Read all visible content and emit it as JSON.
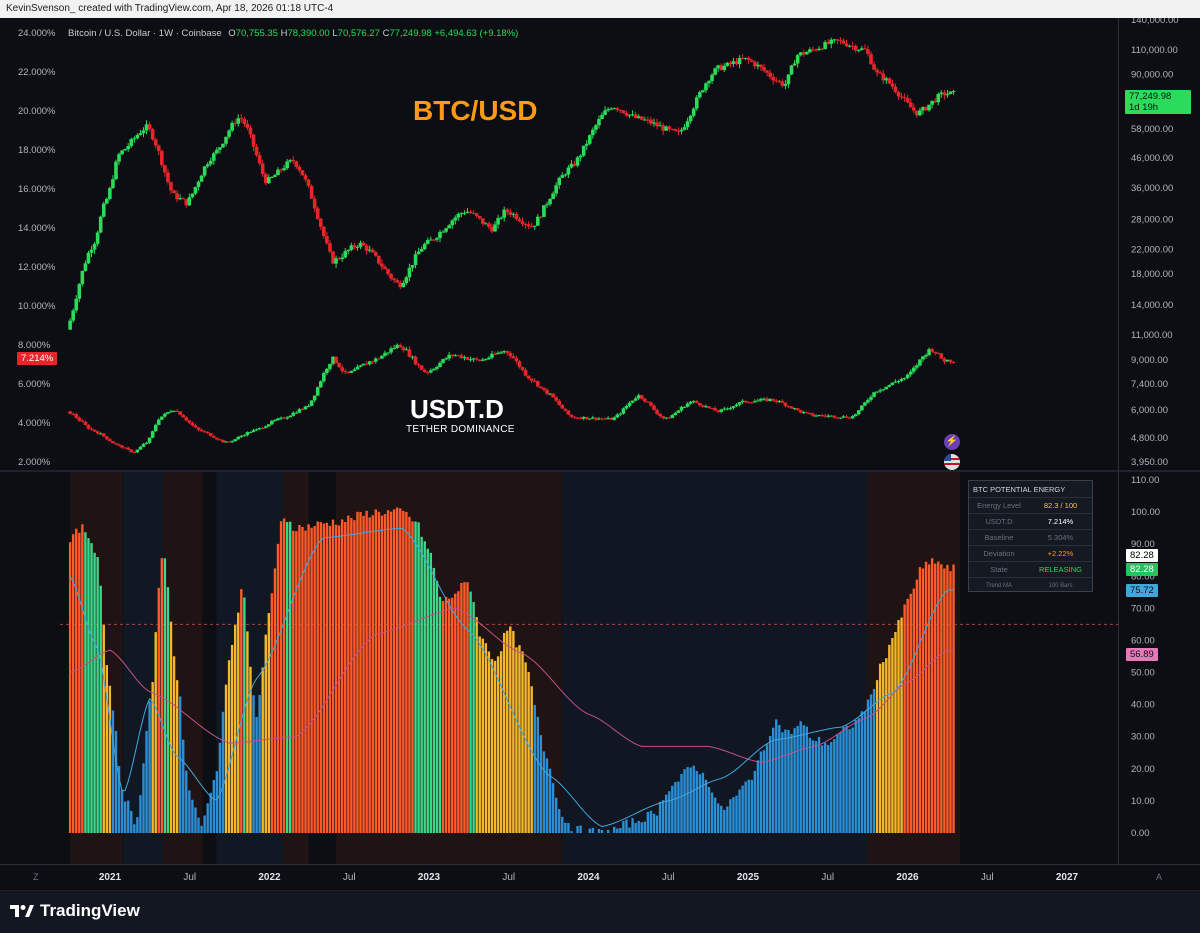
{
  "header": {
    "attribution": "KevinSvenson_ created with TradingView.com, Apr 18, 2026 01:18 UTC-4"
  },
  "legend": {
    "symbol": "Bitcoin / U.S. Dollar · 1W · Coinbase",
    "open_label": "O",
    "open": "70,755.35",
    "high_label": "H",
    "high": "78,390.00",
    "low_label": "L",
    "low": "70,576.27",
    "close_label": "C",
    "close": "77,249.98",
    "change": "+6,494.63 (+9.18%)"
  },
  "annotations": {
    "btc_title": "BTC/USD",
    "usdt_title": "USDT.D",
    "usdt_subtitle": "TETHER DOMINANCE"
  },
  "price_badges": {
    "btc_last": "77,249.98",
    "btc_countdown": "1d 19h",
    "usdt_last": "7.214%",
    "osc_a": "82.28",
    "osc_b": "82.28",
    "osc_c": "75.72",
    "osc_d": "56.89"
  },
  "energy_panel": {
    "title": "BTC POTENTIAL ENERGY",
    "rows": [
      {
        "label": "Energy Level",
        "value": "82.3 / 100"
      },
      {
        "label": "USDT.D",
        "value": "7.214%"
      },
      {
        "label": "Baseline",
        "value": "5.304%"
      },
      {
        "label": "Deviation",
        "value": "+2.22%"
      },
      {
        "label": "State",
        "value": "RELEASING"
      },
      {
        "label": "Trend MA",
        "value": "100 Bars"
      }
    ]
  },
  "footer": {
    "brand": "TradingView"
  },
  "colors": {
    "up": "#2bdc5a",
    "down": "#e8262a",
    "background": "#0c0e13",
    "osc_hot": "#ff5a2a",
    "osc_warm": "#f5b82a",
    "osc_cool": "#2b8fd6",
    "osc_green": "#3ad98a",
    "ma_pink": "#c0508a",
    "ma_blue": "#3fa7dc",
    "ma_yellow": "#e0c070"
  },
  "chart_data": [
    {
      "type": "candlestick",
      "name": "Bitcoin / U.S. Dollar",
      "scale": "log",
      "ylim": [
        3950,
        140000
      ],
      "y_ticks": [
        "140,000.00",
        "110,000.00",
        "90,000.00",
        "72,000.00",
        "58,000.00",
        "46,000.00",
        "36,000.00",
        "28,000.00",
        "22,000.00",
        "18,000.00",
        "14,000.00",
        "11,000.00",
        "9,000.00",
        "7,400.00",
        "6,000.00",
        "4,800.00",
        "3,950.00"
      ],
      "x_ticks": [
        "2021",
        "Jul",
        "2022",
        "Jul",
        "2023",
        "Jul",
        "2024",
        "Jul",
        "2025",
        "Jul",
        "2026",
        "Jul",
        "2027"
      ],
      "anchors": [
        [
          "2020-10",
          11500
        ],
        [
          "2020-12",
          23000
        ],
        [
          "2021-01",
          33000
        ],
        [
          "2021-02",
          48000
        ],
        [
          "2021-04",
          59000
        ],
        [
          "2021-06",
          34000
        ],
        [
          "2021-07",
          32000
        ],
        [
          "2021-09",
          47000
        ],
        [
          "2021-11",
          64000
        ],
        [
          "2022-01",
          38000
        ],
        [
          "2022-03",
          45000
        ],
        [
          "2022-06",
          20000
        ],
        [
          "2022-08",
          23000
        ],
        [
          "2022-11",
          16500
        ],
        [
          "2023-01",
          23000
        ],
        [
          "2023-04",
          30000
        ],
        [
          "2023-06",
          26000
        ],
        [
          "2023-07",
          30000
        ],
        [
          "2023-09",
          26500
        ],
        [
          "2023-12",
          43000
        ],
        [
          "2024-03",
          70000
        ],
        [
          "2024-05",
          63000
        ],
        [
          "2024-08",
          56000
        ],
        [
          "2024-11",
          95000
        ],
        [
          "2025-01",
          102000
        ],
        [
          "2025-04",
          83000
        ],
        [
          "2025-05",
          106000
        ],
        [
          "2025-08",
          118000
        ],
        [
          "2025-10",
          110000
        ],
        [
          "2025-11",
          90000
        ],
        [
          "2026-02",
          66000
        ],
        [
          "2026-04",
          77250
        ]
      ]
    },
    {
      "type": "candlestick",
      "name": "USDT.D",
      "ylim": [
        2.0,
        24.0
      ],
      "y_ticks": [
        "24.000%",
        "22.000%",
        "20.000%",
        "18.000%",
        "16.000%",
        "14.000%",
        "12.000%",
        "10.000%",
        "8.000%",
        "6.000%",
        "4.000%",
        "2.000%"
      ],
      "anchors": [
        [
          "2020-10",
          4.6
        ],
        [
          "2020-12",
          3.6
        ],
        [
          "2021-02",
          2.8
        ],
        [
          "2021-03",
          2.5
        ],
        [
          "2021-04",
          3.0
        ],
        [
          "2021-05",
          4.3
        ],
        [
          "2021-06",
          4.7
        ],
        [
          "2021-08",
          3.6
        ],
        [
          "2021-10",
          3.0
        ],
        [
          "2021-12",
          3.6
        ],
        [
          "2022-02",
          4.2
        ],
        [
          "2022-04",
          4.8
        ],
        [
          "2022-06",
          7.3
        ],
        [
          "2022-07",
          6.5
        ],
        [
          "2022-09",
          7.2
        ],
        [
          "2022-11",
          8.0
        ],
        [
          "2023-01",
          6.6
        ],
        [
          "2023-03",
          7.5
        ],
        [
          "2023-05",
          7.2
        ],
        [
          "2023-07",
          7.7
        ],
        [
          "2023-09",
          6.2
        ],
        [
          "2023-10",
          5.6
        ],
        [
          "2023-12",
          4.3
        ],
        [
          "2024-03",
          4.2
        ],
        [
          "2024-05",
          5.4
        ],
        [
          "2024-07",
          4.2
        ],
        [
          "2024-09",
          5.1
        ],
        [
          "2024-11",
          4.6
        ],
        [
          "2025-01",
          5.1
        ],
        [
          "2025-03",
          5.2
        ],
        [
          "2025-06",
          4.4
        ],
        [
          "2025-09",
          4.3
        ],
        [
          "2025-11",
          5.7
        ],
        [
          "2026-01",
          6.3
        ],
        [
          "2026-03",
          7.8
        ],
        [
          "2026-04",
          7.214
        ]
      ]
    },
    {
      "type": "bar",
      "name": "BTC Potential Energy",
      "ylim": [
        0,
        110
      ],
      "y_ticks": [
        "110.00",
        "100.00",
        "90.00",
        "80.00",
        "70.00",
        "60.00",
        "50.00",
        "40.00",
        "30.00",
        "20.00",
        "10.00",
        "0.00"
      ],
      "reference_line": 65,
      "anchors": [
        [
          "2020-10",
          92
        ],
        [
          "2020-11",
          95
        ],
        [
          "2020-12",
          88
        ],
        [
          "2021-01",
          45
        ],
        [
          "2021-02",
          12
        ],
        [
          "2021-03",
          3
        ],
        [
          "2021-04",
          40
        ],
        [
          "2021-05",
          90
        ],
        [
          "2021-06",
          50
        ],
        [
          "2021-07",
          12
        ],
        [
          "2021-08",
          3
        ],
        [
          "2021-09",
          20
        ],
        [
          "2021-10",
          55
        ],
        [
          "2021-11",
          77
        ],
        [
          "2021-12",
          35
        ],
        [
          "2022-01",
          70
        ],
        [
          "2022-02",
          99
        ],
        [
          "2022-03",
          95
        ],
        [
          "2022-06",
          97
        ],
        [
          "2022-09",
          100
        ],
        [
          "2022-11",
          100
        ],
        [
          "2022-12",
          97
        ],
        [
          "2023-01",
          88
        ],
        [
          "2023-02",
          72
        ],
        [
          "2023-04",
          78
        ],
        [
          "2023-05",
          60
        ],
        [
          "2023-06",
          54
        ],
        [
          "2023-07",
          64
        ],
        [
          "2023-08",
          56
        ],
        [
          "2023-10",
          22
        ],
        [
          "2023-11",
          5
        ],
        [
          "2023-12",
          1
        ],
        [
          "2024-02",
          0
        ],
        [
          "2024-03",
          1
        ],
        [
          "2024-04",
          3
        ],
        [
          "2024-06",
          6
        ],
        [
          "2024-07",
          14
        ],
        [
          "2024-09",
          21
        ],
        [
          "2024-10",
          16
        ],
        [
          "2024-11",
          7
        ],
        [
          "2024-12",
          11
        ],
        [
          "2025-01",
          16
        ],
        [
          "2025-02",
          24
        ],
        [
          "2025-03",
          35
        ],
        [
          "2025-04",
          31
        ],
        [
          "2025-05",
          34
        ],
        [
          "2025-06",
          29
        ],
        [
          "2025-07",
          28
        ],
        [
          "2025-09",
          34
        ],
        [
          "2025-10",
          40
        ],
        [
          "2025-11",
          52
        ],
        [
          "2025-12",
          62
        ],
        [
          "2026-01",
          72
        ],
        [
          "2026-02",
          82
        ],
        [
          "2026-03",
          85
        ],
        [
          "2026-04",
          82.3
        ]
      ],
      "highlight_ranges": [
        [
          "2020-10",
          "2021-01"
        ],
        [
          "2021-05",
          "2021-07"
        ],
        [
          "2022-02",
          "2022-03"
        ],
        [
          "2022-06",
          "2023-10"
        ],
        [
          "2025-10",
          "2026-04"
        ]
      ],
      "ma_pink": [
        [
          "2020-10",
          50
        ],
        [
          "2021-01",
          57
        ],
        [
          "2021-04",
          44
        ],
        [
          "2021-10",
          28
        ],
        [
          "2022-03",
          30
        ],
        [
          "2022-09",
          62
        ],
        [
          "2023-03",
          70
        ],
        [
          "2023-08",
          56
        ],
        [
          "2024-01",
          37
        ],
        [
          "2024-05",
          27
        ],
        [
          "2024-10",
          27
        ],
        [
          "2025-02",
          22
        ],
        [
          "2025-06",
          27
        ],
        [
          "2025-10",
          36
        ],
        [
          "2026-01",
          47
        ],
        [
          "2026-04",
          56.89
        ]
      ],
      "ma_blue": [
        [
          "2020-10",
          80
        ],
        [
          "2020-12",
          58
        ],
        [
          "2021-02",
          12
        ],
        [
          "2021-04",
          42
        ],
        [
          "2021-06",
          24
        ],
        [
          "2021-09",
          10
        ],
        [
          "2021-12",
          48
        ],
        [
          "2022-05",
          92
        ],
        [
          "2022-11",
          95
        ],
        [
          "2023-04",
          63
        ],
        [
          "2023-10",
          18
        ],
        [
          "2024-02",
          2
        ],
        [
          "2024-07",
          10
        ],
        [
          "2024-11",
          17
        ],
        [
          "2025-03",
          29
        ],
        [
          "2025-08",
          33
        ],
        [
          "2025-12",
          44
        ],
        [
          "2026-04",
          75.72
        ]
      ]
    }
  ]
}
